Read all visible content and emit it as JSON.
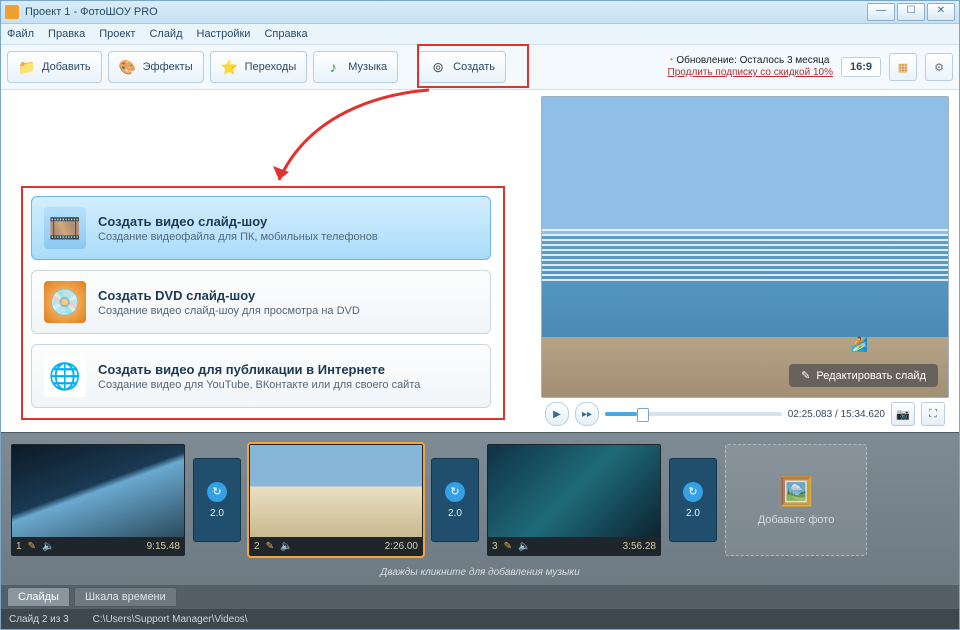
{
  "window": {
    "title": "Проект 1 - ФотоШОУ PRO"
  },
  "menu": {
    "items": [
      "Файл",
      "Правка",
      "Проект",
      "Слайд",
      "Настройки",
      "Справка"
    ]
  },
  "toolbar": {
    "add": "Добавить",
    "effects": "Эффекты",
    "transitions": "Переходы",
    "music": "Музыка",
    "create": "Создать"
  },
  "promo": {
    "line1": "Обновление: Осталось 3 месяца",
    "line2": "Продлить подписку со скидкой 10%"
  },
  "aspect": "16:9",
  "options": [
    {
      "title": "Создать видео слайд-шоу",
      "desc": "Создание видеофайла для ПК, мобильных телефонов",
      "icon": "video",
      "selected": true
    },
    {
      "title": "Создать DVD слайд-шоу",
      "desc": "Создание видео слайд-шоу для просмотра на DVD",
      "icon": "dvd",
      "selected": false
    },
    {
      "title": "Создать видео для публикации в Интернете",
      "desc": "Создание видео для YouTube, ВКонтакте или для своего сайта",
      "icon": "web",
      "selected": false
    }
  ],
  "preview": {
    "edit_label": "Редактировать слайд",
    "time": "02:25.083 / 15:34.620"
  },
  "timeline": {
    "slides": [
      {
        "index": "1",
        "duration": "9:15.48",
        "trans": "2.0"
      },
      {
        "index": "2",
        "duration": "2:26.00",
        "trans": "2.0",
        "active": true
      },
      {
        "index": "3",
        "duration": "3:56.28",
        "trans": "2.0"
      }
    ],
    "add_label": "Добавьте фото",
    "music_hint": "Дважды кликните для добавления музыки"
  },
  "tabs": {
    "slides": "Слайды",
    "timeline": "Шкала времени"
  },
  "status": {
    "pos": "Слайд 2 из 3",
    "path": "C:\\Users\\Support Manager\\Videos\\"
  }
}
